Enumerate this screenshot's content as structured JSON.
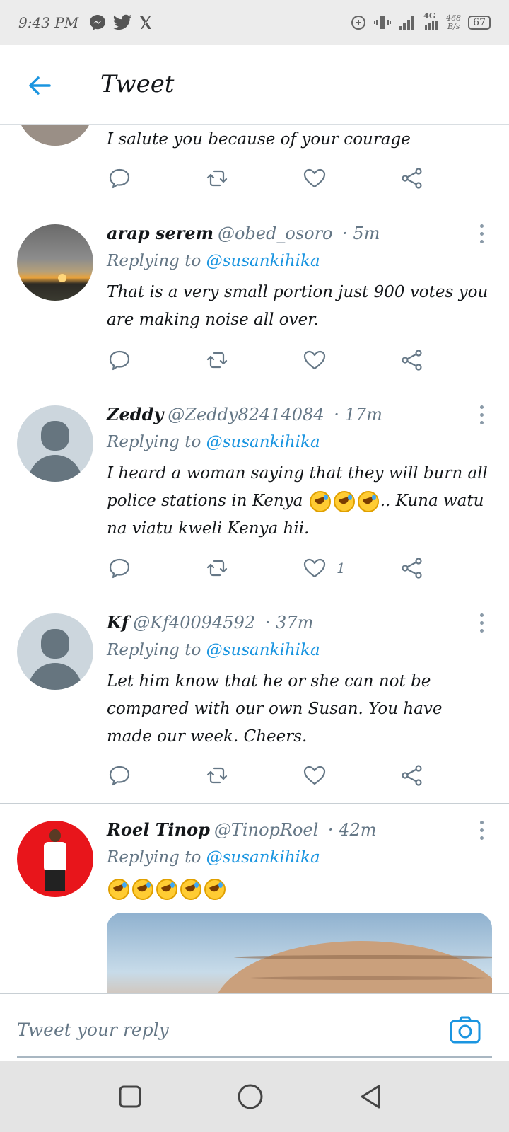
{
  "status_bar": {
    "time": "9:43 PM",
    "network": "4G",
    "speed_value": "468",
    "speed_unit": "B/s",
    "battery": "67",
    "icons": [
      "messenger-icon",
      "twitter-icon",
      "x-icon",
      "data-saver-icon",
      "vibrate-icon",
      "signal-icon",
      "signal-4g-icon",
      "battery-icon"
    ]
  },
  "app_bar": {
    "title": "Tweet",
    "back_icon": "back-arrow-icon"
  },
  "colors": {
    "accent": "#1b95e0",
    "text_secondary": "#657786",
    "divider": "#c8cfd4"
  },
  "tweets": [
    {
      "body": "I salute you because of your courage"
    },
    {
      "name": "arap serem",
      "handle": "@obed_osoro",
      "time": "· 5m",
      "replying_label": "Replying to",
      "replying_to": "@susankihika",
      "body": "That is a very small portion just 900 votes you are making noise all over."
    },
    {
      "name": "Zeddy",
      "handle": "@Zeddy82414084",
      "time": "· 17m",
      "replying_label": "Replying to",
      "replying_to": "@susankihika",
      "body_before": "I heard a woman saying that they will burn all police stations in Kenya",
      "body_after": ".. Kuna watu na viatu kweli Kenya hii.",
      "like_count": "1"
    },
    {
      "name": "Kf",
      "handle": "@Kf40094592",
      "time": "· 37m",
      "replying_label": "Replying to",
      "replying_to": "@susankihika",
      "body": "Let him know that he or she can not be compared with our own Susan. You have made our week. Cheers."
    },
    {
      "name": "Roel Tinop",
      "handle": "@TinopRoel",
      "time": "· 42m",
      "replying_label": "Replying to",
      "replying_to": "@susankihika"
    }
  ],
  "composer": {
    "placeholder": "Tweet your reply",
    "camera_icon": "camera-icon"
  },
  "nav": {
    "icons": [
      "recents-square-icon",
      "home-circle-icon",
      "back-triangle-icon"
    ]
  }
}
